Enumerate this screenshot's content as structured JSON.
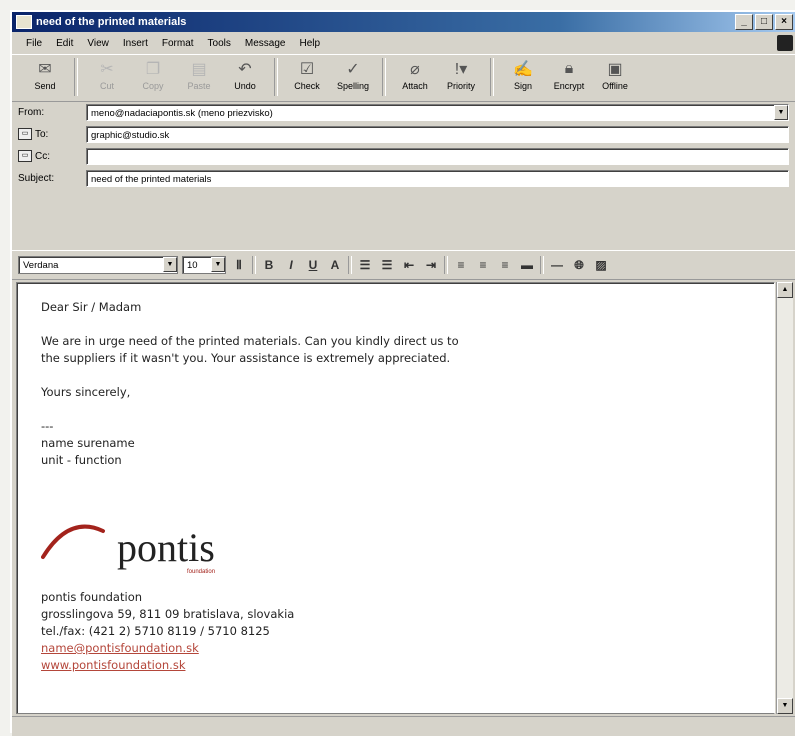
{
  "window": {
    "title": "need of the printed materials",
    "controls": [
      "_",
      "□",
      "×"
    ]
  },
  "menu": [
    "File",
    "Edit",
    "View",
    "Insert",
    "Format",
    "Tools",
    "Message",
    "Help"
  ],
  "toolbar": {
    "send": "Send",
    "cut": "Cut",
    "copy": "Copy",
    "paste": "Paste",
    "undo": "Undo",
    "check": "Check",
    "spelling": "Spelling",
    "attach": "Attach",
    "priority": "Priority",
    "sign": "Sign",
    "encrypt": "Encrypt",
    "offline": "Offline"
  },
  "headers": {
    "from_label": "From:",
    "from_value": "meno@nadaciapontis.sk   (meno priezvisko)",
    "to_label": "To:",
    "to_value": "graphic@studio.sk",
    "cc_label": "Cc:",
    "cc_value": "",
    "subject_label": "Subject:",
    "subject_value": "need of the printed materials"
  },
  "format": {
    "font": "Verdana",
    "size": "10"
  },
  "message": {
    "greeting": "Dear Sir / Madam",
    "line1": "We are in urge need of the printed materials. Can you kindly direct us to",
    "line2": "the suppliers if it wasn't you. Your assistance is extremely appreciated.",
    "closing": "Yours sincerely,",
    "dashes": "---",
    "name": "name surename",
    "unit": "unit - function"
  },
  "logo": {
    "text": "pontis",
    "sub": "foundation"
  },
  "signature": {
    "org": "pontis foundation",
    "address": "grosslingova 59, 811 09 bratislava, slovakia",
    "phone": "tel./fax: (421 2) 5710 8119 / 5710 8125",
    "email": "name@pontisfoundation.sk",
    "web": "www.pontisfoundation.sk"
  },
  "colors": {
    "titlebar": "#0a246a",
    "link": "#b4463a",
    "logo_arc": "#a3231c",
    "logo_text": "#222222"
  }
}
